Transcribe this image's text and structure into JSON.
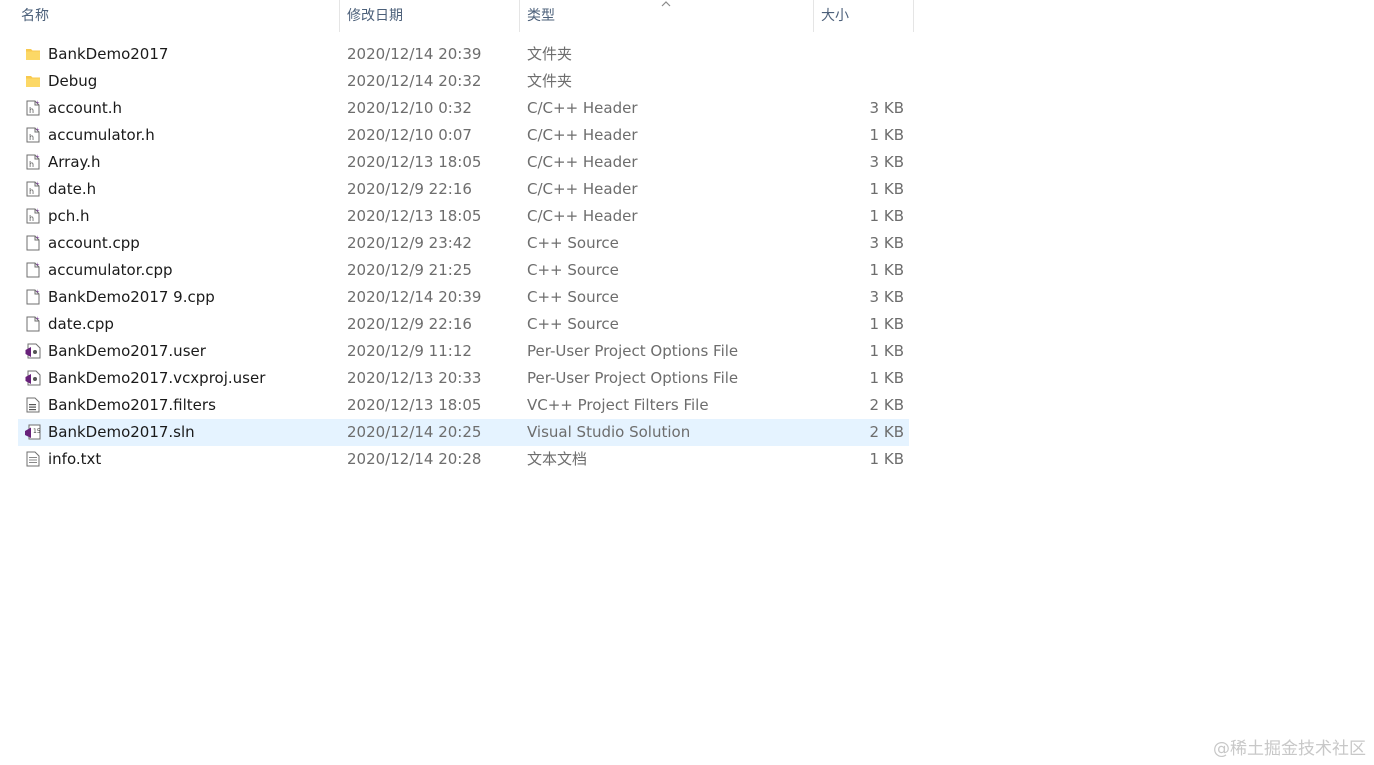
{
  "columns": {
    "name": "名称",
    "date": "修改日期",
    "type": "类型",
    "size": "大小"
  },
  "sort_indicator_icon": "chevron-up-icon",
  "files": [
    {
      "name": "BankDemo2017",
      "date": "2020/12/14 20:39",
      "type": "文件夹",
      "size": "",
      "icon": "folder-icon"
    },
    {
      "name": "Debug",
      "date": "2020/12/14 20:32",
      "type": "文件夹",
      "size": "",
      "icon": "folder-icon"
    },
    {
      "name": "account.h",
      "date": "2020/12/10 0:32",
      "type": "C/C++ Header",
      "size": "3 KB",
      "icon": "header-file-icon"
    },
    {
      "name": "accumulator.h",
      "date": "2020/12/10 0:07",
      "type": "C/C++ Header",
      "size": "1 KB",
      "icon": "header-file-icon"
    },
    {
      "name": "Array.h",
      "date": "2020/12/13 18:05",
      "type": "C/C++ Header",
      "size": "3 KB",
      "icon": "header-file-icon"
    },
    {
      "name": "date.h",
      "date": "2020/12/9 22:16",
      "type": "C/C++ Header",
      "size": "1 KB",
      "icon": "header-file-icon"
    },
    {
      "name": "pch.h",
      "date": "2020/12/13 18:05",
      "type": "C/C++ Header",
      "size": "1 KB",
      "icon": "header-file-icon"
    },
    {
      "name": "account.cpp",
      "date": "2020/12/9 23:42",
      "type": "C++ Source",
      "size": "3 KB",
      "icon": "source-file-icon"
    },
    {
      "name": "accumulator.cpp",
      "date": "2020/12/9 21:25",
      "type": "C++ Source",
      "size": "1 KB",
      "icon": "source-file-icon"
    },
    {
      "name": "BankDemo2017 9.cpp",
      "date": "2020/12/14 20:39",
      "type": "C++ Source",
      "size": "3 KB",
      "icon": "source-file-icon"
    },
    {
      "name": "date.cpp",
      "date": "2020/12/9 22:16",
      "type": "C++ Source",
      "size": "1 KB",
      "icon": "source-file-icon"
    },
    {
      "name": "BankDemo2017.user",
      "date": "2020/12/9 11:12",
      "type": "Per-User Project Options File",
      "size": "1 KB",
      "icon": "vs-user-file-icon"
    },
    {
      "name": "BankDemo2017.vcxproj.user",
      "date": "2020/12/13 20:33",
      "type": "Per-User Project Options File",
      "size": "1 KB",
      "icon": "vs-user-file-icon"
    },
    {
      "name": "BankDemo2017.filters",
      "date": "2020/12/13 18:05",
      "type": "VC++ Project Filters File",
      "size": "2 KB",
      "icon": "filters-file-icon"
    },
    {
      "name": "BankDemo2017.sln",
      "date": "2020/12/14 20:25",
      "type": "Visual Studio Solution",
      "size": "2 KB",
      "icon": "vs-solution-icon",
      "selected": true
    },
    {
      "name": "info.txt",
      "date": "2020/12/14 20:28",
      "type": "文本文档",
      "size": "1 KB",
      "icon": "text-file-icon"
    }
  ],
  "watermark": "@稀土掘金技术社区",
  "colors": {
    "header_text": "#4c607a",
    "name_text": "#1a1a1a",
    "meta_text": "#6d6d6d",
    "selection": "#e5f3ff",
    "folder": "#f8c94e",
    "vs_purple": "#68217a"
  }
}
